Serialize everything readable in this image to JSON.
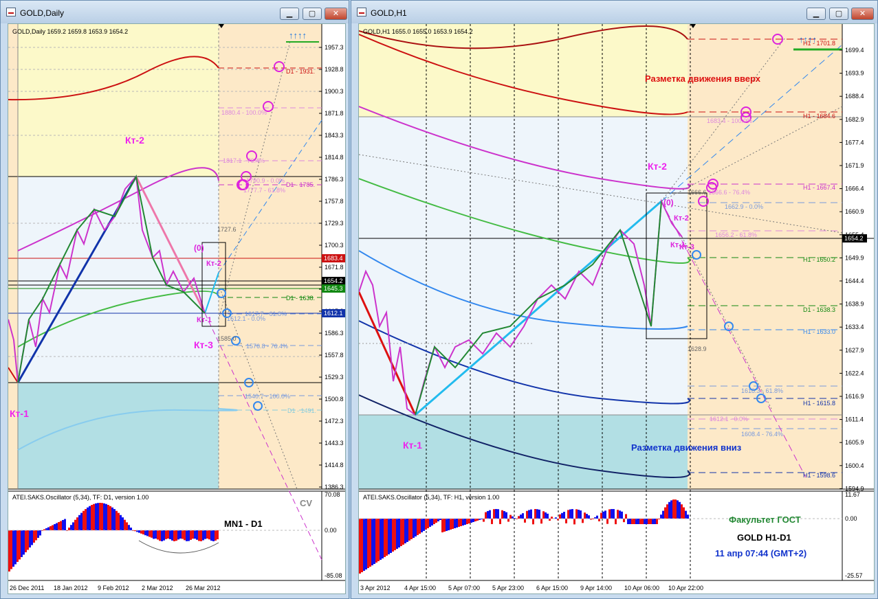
{
  "left_window": {
    "title": "GOLD,Daily",
    "header": "GOLD,Daily  1659.2 1659.8 1653.9 1654.2",
    "price_labels": [
      "1957.3",
      "1928.8",
      "1900.3",
      "1871.8",
      "1843.3",
      "1814.8",
      "1786.3",
      "1757.8",
      "1729.3",
      "1700.3",
      "1671.8",
      "1643.3",
      "1615.8",
      "1586.3",
      "1557.8",
      "1529.3",
      "1500.8",
      "1472.3",
      "1443.3",
      "1414.8",
      "1386.3"
    ],
    "badges": [
      {
        "text": "1683.4",
        "color": "#cc1111"
      },
      {
        "text": "1654.2",
        "color": "#000000"
      },
      {
        "text": "1645.3",
        "color": "#118811"
      },
      {
        "text": "1612.1",
        "color": "#1133aa"
      }
    ],
    "level_labels": {
      "d1_1931": "D1 - 1931.",
      "d1_1785": "D1 - 1785.",
      "d1_1638": "D1 - 1638.",
      "d1_1491": "D1 - 1491.",
      "fib_1880": "1880.4 - 100.0%",
      "fib_1817": "1817.1 - 76.4%",
      "fib_1790": "1790.9 - 0.0%",
      "fib_1777": "1777.7 - 61.8%",
      "v1727": "1727.6",
      "fib_1617": "1617.7 - 61.8%",
      "fib_1612": "1612.1 - 0.0%",
      "v1585": "1585.0",
      "fib_1576": "1576.8 - 76.4%",
      "fib_1540": "1540.7 - 100.0%"
    },
    "annotations": {
      "kt2": "Кт-2",
      "kt1_left": "Кт-1",
      "zero": "(0)",
      "kt2_small": "Кт-2",
      "kt1_small": "Кт-1",
      "kt3": "Кт-3"
    },
    "arrows": "↑↑↑↑",
    "oscillator": {
      "header": "ATEI.SAKS.Oscillator (5,34), TF: D1, version 1.00",
      "cv": "CV",
      "label": "MN1 - D1",
      "scale": [
        "70.08",
        "0.00",
        "-85.08"
      ]
    },
    "time_labels": [
      "26 Dec 2011",
      "18 Jan 2012",
      "9 Feb 2012",
      "2 Mar 2012",
      "26 Mar 2012"
    ]
  },
  "right_window": {
    "title": "GOLD,H1",
    "header": "GOLD,H1  1655.0 1655.0 1653.9 1654.2",
    "price_labels": [
      "1699.4",
      "1693.9",
      "1688.4",
      "1682.9",
      "1677.4",
      "1671.9",
      "1666.4",
      "1660.9",
      "1655.4",
      "1649.9",
      "1644.4",
      "1638.9",
      "1633.4",
      "1627.9",
      "1622.4",
      "1616.9",
      "1611.4",
      "1605.9",
      "1600.4",
      "1594.9"
    ],
    "current_price": "1654.2",
    "level_labels": {
      "h1_1701": "H1 - 1701.8",
      "h1_1684": "H1 - 1684.6",
      "fib_1683": "1683.4 - 100.0%",
      "h1_1667": "H1 - 1667.4",
      "v1666": "1666.6",
      "fib_1666": "1666.6 - 76.4%",
      "fib_1662": "1662.9 - 0.0%",
      "fib_1656": "1656.2 - 61.8%",
      "h1_1650": "H1 - 1650.2",
      "d1_1638": "D1 - 1638.3",
      "h1_1633": "H1 - 1633.0",
      "v1628": "1628.9",
      "fib_1618": "1618.3 - 61.8%",
      "h1_1615": "H1 - 1615.8",
      "fib_1612": "1612.1 - 0.0%",
      "fib_1608": "1608.4 - 76.4%",
      "h1_1598": "H1 - 1598.6"
    },
    "annotations": {
      "up": "Разметка движения вверх",
      "down": "Разметка движения вниз",
      "kt2": "Кт-2",
      "kt1": "Кт-1",
      "zero": "(0)",
      "kt2_small": "Кт-2",
      "kt1_small": "Кт-1",
      "kt3": "Кт-3"
    },
    "arrows": "↑↑↑↑",
    "oscillator": {
      "header": "ATEI.SAKS.Oscillator (5,34), TF: H1, version 1.00",
      "scale": [
        "11.67",
        "0.00",
        "-25.57"
      ],
      "faculty": "Факультет ГОСТ",
      "instrument": "GOLD   H1-D1",
      "datetime": "11 апр 07:44  (GMT+2)"
    },
    "time_labels": [
      "3 Apr 2012",
      "4 Apr 15:00",
      "5 Apr 07:00",
      "5 Apr 23:00",
      "6 Apr 15:00",
      "9 Apr 14:00",
      "10 Apr 06:00",
      "10 Apr 22:00"
    ]
  },
  "window_buttons": {
    "minimize": "▁",
    "maximize": "▢",
    "close": "✕"
  }
}
